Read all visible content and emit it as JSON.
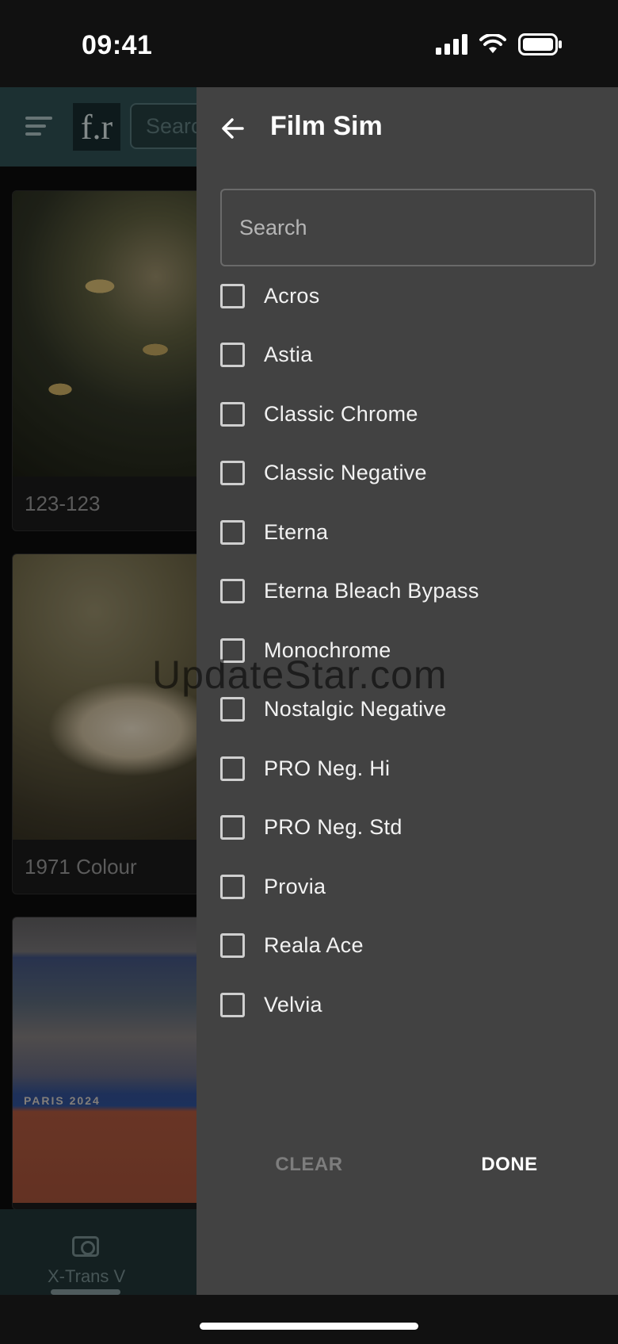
{
  "status_bar": {
    "time": "09:41"
  },
  "background_app": {
    "logo": "f.r",
    "search_placeholder": "Search",
    "cards": [
      {
        "caption": "123-123"
      },
      {
        "caption": "1971 Colour"
      },
      {
        "caption": "",
        "image_text": "PARIS 2024"
      }
    ],
    "bottom_nav": {
      "label": "X-Trans V"
    }
  },
  "drawer": {
    "title": "Film Sim",
    "search_placeholder": "Search",
    "options": [
      {
        "label": "Acros",
        "checked": false
      },
      {
        "label": "Astia",
        "checked": false
      },
      {
        "label": "Classic Chrome",
        "checked": false
      },
      {
        "label": "Classic Negative",
        "checked": false
      },
      {
        "label": "Eterna",
        "checked": false
      },
      {
        "label": "Eterna Bleach Bypass",
        "checked": false
      },
      {
        "label": "Monochrome",
        "checked": false
      },
      {
        "label": "Nostalgic Negative",
        "checked": false
      },
      {
        "label": "PRO Neg. Hi",
        "checked": false
      },
      {
        "label": "PRO Neg. Std",
        "checked": false
      },
      {
        "label": "Provia",
        "checked": false
      },
      {
        "label": "Reala Ace",
        "checked": false
      },
      {
        "label": "Velvia",
        "checked": false
      }
    ],
    "clear_label": "CLEAR",
    "done_label": "DONE"
  },
  "watermark": "UpdateStar.com",
  "colors": {
    "drawer_background": "#424242",
    "toolbar_teal": "#2c4a4d",
    "disabled_text": "#7d7d7d"
  }
}
